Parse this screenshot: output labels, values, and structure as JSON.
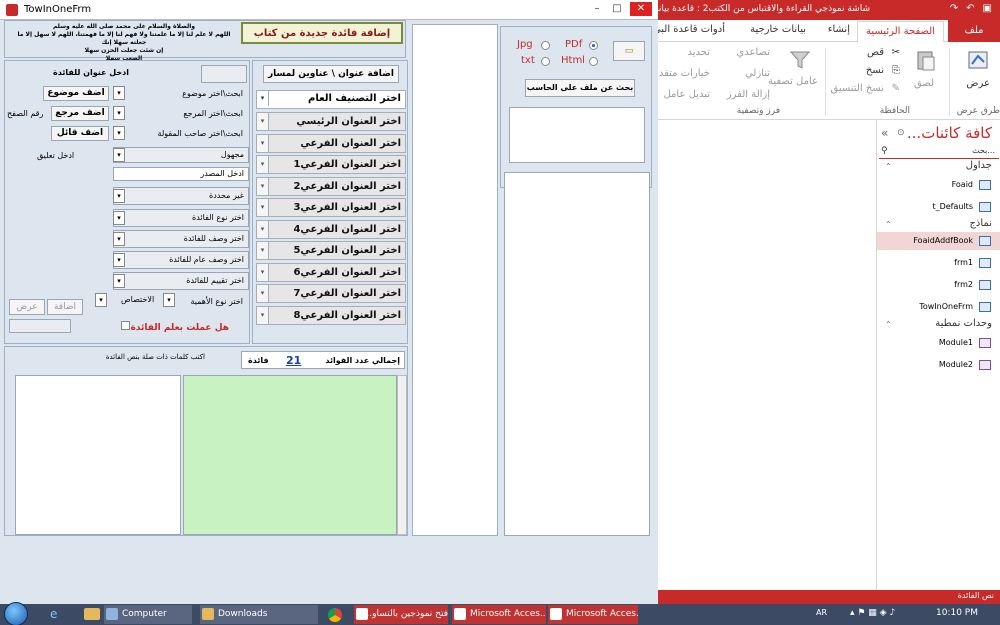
{
  "access": {
    "title": "شاشة نموذجي القراءة والاقتباس من الكتب2 : قاعدة بيانات",
    "tabs": {
      "file": "ملف",
      "home": "الصفحة الرئيسية",
      "create": "إنشاء",
      "external": "بيانات خارجية",
      "dbtools": "أدوات قاعدة البي"
    },
    "ribbon": {
      "views": "عرض",
      "views_group": "طرق عرض",
      "paste": "لصق",
      "cut": "قص",
      "copy": "نسخ",
      "format_painter": "نسخ التنسيق",
      "clipboard_group": "الحافظة",
      "filter": "عامل تصفية",
      "ascending": "تصاعدي",
      "descending": "تنازلي",
      "remove_sort": "إزالة الفرز",
      "selection": "تحديد",
      "advanced": "خيارات متقد",
      "toggle_filter": "تبديل عامل",
      "sort_group": "فرز وتصفية"
    },
    "nav": {
      "header": "كافة كائنات...",
      "search_placeholder": "بحث...",
      "sections": [
        {
          "label": "جداول",
          "items": [
            "Foaid",
            "t_Defaults"
          ]
        },
        {
          "label": "نماذج",
          "items": [
            "FoaidAddfBook",
            "frm1",
            "frm2",
            "TowInOneFrm"
          ]
        },
        {
          "label": "وحدات نمطية",
          "items": [
            "Module1",
            "Module2"
          ]
        }
      ],
      "selected": "FoaidAddfBook"
    },
    "status_text": "نص الفائدة"
  },
  "form": {
    "window_title": "TowInOneFrm",
    "dua_text": "والصلاة والسلام على محمد صلى الله عليه وسلم\nاللهم لا علم لنا إلا ما علمتنا ولا فهم لنا إلا ما فهمتنا، اللهم لا سهل إلا ما جعلته سهلا إنك\nإن شئت جعلت الحزن سهلا\nالصعب سهلا",
    "add_new_btn": "إضافة فائدة جديدة من كتاب",
    "left_panel": {
      "enter_title_label": "ادخل عنوان للفائدة",
      "search_topic": "ابحث\\اختر موضوع",
      "add_topic_btn": "اضف موضوع",
      "search_ref": "ابحث\\اختر المرجع",
      "add_ref_btn": "اضف مرجع",
      "page_no": "رقم الصفح",
      "search_author": "ابحث\\اختر صاحب المقولة",
      "add_author_btn": "اضف قائل",
      "unknown": "مجهول",
      "comment_label": "ادخل تعليق",
      "source_label": "ادخل المصدر",
      "undefined": "غير محددة",
      "type_label": "اختر نوع الفائدة",
      "desc_label": "اختر وصف للفائدة",
      "general_desc_label": "اختر وصف عام للفائدة",
      "rating_label": "اختر تقييم للفائدة",
      "importance_label": "اختر نوع الأهمية",
      "specialty_label": "الاختصاص",
      "add_btn": "اضافة",
      "show_btn": "عرض",
      "did_you_act": "هل عملت بعلم الفائدة ؟"
    },
    "classification": {
      "add_title_btn": "اضافة عنوان \\ عناوين لمسار",
      "general": "اختر التصنيف العام",
      "rows": [
        "اختر العنوان الرئيسي",
        "اختر العنوان الفرعي",
        "اختر العنوان الفرعي1",
        "اختر العنوان الفرعي2",
        "اختر العنوان الفرعي3",
        "اختر العنوان الفرعي4",
        "اختر العنوان الفرعي5",
        "اختر العنوان الفرعي6",
        "اختر العنوان الفرعي7",
        "اختر العنوان الفرعي8"
      ]
    },
    "file_panel": {
      "options": [
        {
          "label": "PDf",
          "checked": true
        },
        {
          "label": "Jpg",
          "checked": false
        },
        {
          "label": "Html",
          "checked": false
        },
        {
          "label": "txt",
          "checked": false
        }
      ],
      "search_btn": "بحث عن ملف على الحاسب"
    },
    "bottom": {
      "related_words": "اكتب كلمات ذات صلة بنص الفائدة",
      "total_label": "إجمالي عدد الفوائد",
      "total_value": "21",
      "unit": "فائدة"
    }
  },
  "taskbar": {
    "computer": "Computer",
    "downloads": "Downloads",
    "item1": "فتح نموذجين بالتساو...",
    "item2": "Microsoft Acces...",
    "item3": "Microsoft Acces...",
    "lang": "AR",
    "time": "10:10 PM"
  }
}
